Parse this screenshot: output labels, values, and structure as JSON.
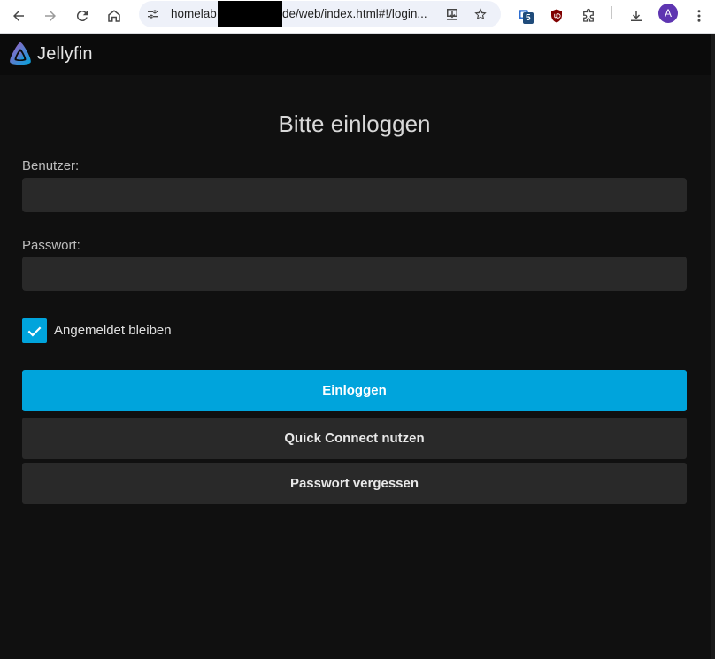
{
  "browser": {
    "url_start": "homelab",
    "url_end": "de/web/index.html#!/login...",
    "extension_badge": "5",
    "avatar_letter": "A",
    "accent_color": "#00a4dc"
  },
  "app": {
    "name": "Jellyfin"
  },
  "login": {
    "title": "Bitte einloggen",
    "username_label": "Benutzer:",
    "username_value": "",
    "password_label": "Passwort:",
    "password_value": "",
    "remember_label": "Angemeldet bleiben",
    "remember_checked": true,
    "login_button": "Einloggen",
    "quick_connect_button": "Quick Connect nutzen",
    "forgot_password_button": "Passwort vergessen"
  }
}
